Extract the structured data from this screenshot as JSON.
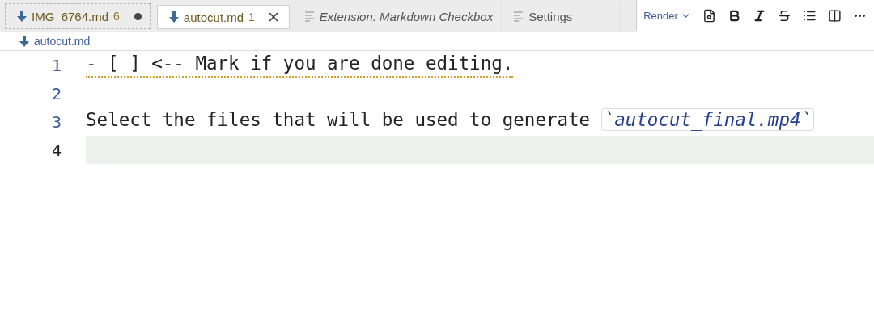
{
  "tabs": [
    {
      "label": "IMG_6764.md",
      "count": "6",
      "kind": "markdown",
      "dirty": true,
      "selected": false,
      "preview": false,
      "focused": true
    },
    {
      "label": "autocut.md",
      "count": "1",
      "kind": "markdown",
      "dirty": false,
      "selected": true,
      "preview": false,
      "focused": false
    },
    {
      "label": "Extension: Markdown Checkbox",
      "kind": "document",
      "dirty": false,
      "selected": false,
      "preview": true,
      "focused": false
    },
    {
      "label": "Settings",
      "kind": "document",
      "dirty": false,
      "selected": false,
      "preview": false,
      "focused": false
    }
  ],
  "toolbar": {
    "mode": "Render"
  },
  "breadcrumb": {
    "label": "autocut.md"
  },
  "lines": [
    {
      "number": "1",
      "current": false,
      "warning": true,
      "segments": [
        {
          "kind": "marker",
          "text": "-"
        },
        {
          "kind": "text",
          "text": " [ ] <-- Mark if you are done editing."
        }
      ]
    },
    {
      "number": "2",
      "current": false
    },
    {
      "number": "3",
      "current": false,
      "warning": false,
      "segments": [
        {
          "kind": "text",
          "text": "Select the files that will be used to generate "
        },
        {
          "kind": "code",
          "text": "`autocut_final.mp4`"
        }
      ]
    },
    {
      "number": "4",
      "current": true
    }
  ]
}
